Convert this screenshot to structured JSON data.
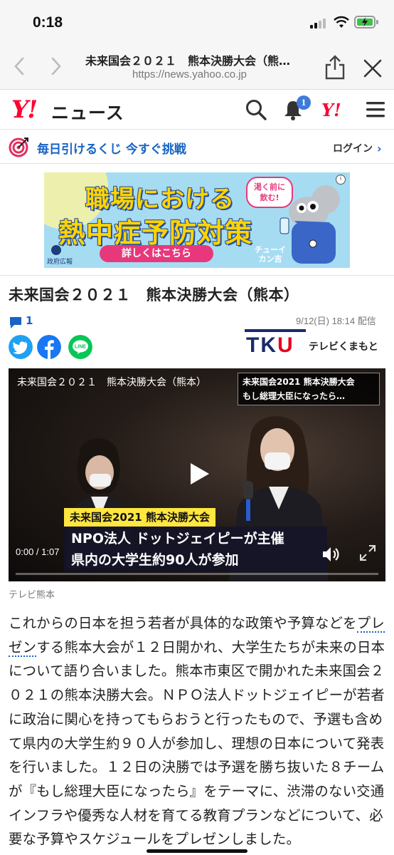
{
  "status_bar": {
    "time": "0:18"
  },
  "browser": {
    "page_title": "未来国会２０２１　熊本決勝大会（熊…",
    "url": "https://news.yahoo.co.jp"
  },
  "header": {
    "logo": "Y!",
    "section": "ニュース",
    "notification_count": "1",
    "y_small": "Y!"
  },
  "lottery": {
    "text": "毎日引けるくじ 今すぐ挑戦",
    "login": "ログイン",
    "chevron": "›"
  },
  "ad": {
    "line1": "職場における",
    "line2": "熱中症予防対策",
    "cta": "詳しくはこちら",
    "bubble": "渇く前に\n飲む!",
    "gov_label": "政府広報",
    "character_line1": "チューイ",
    "character_line2": "カン吉",
    "info": "i"
  },
  "article": {
    "title": "未来国会２０２１　熊本決勝大会（熊本）",
    "comment_count": "1",
    "date": "9/12(日) 18:14 配信",
    "publisher_letters": "TK",
    "publisher_letter_u": "U",
    "publisher_sub": "テレビくまもと"
  },
  "video": {
    "title": "未来国会２０２１　熊本決勝大会（熊本）",
    "tr_line1": "未来国会2021 熊本決勝大会",
    "tr_line2": "もし総理大臣になったら…",
    "caption1": "未来国会2021 熊本決勝大会",
    "caption2_line1": "NPO法人 ドットジェイピーが主催",
    "caption2_line2": "県内の大学生約90人が参加",
    "time": "0:00 / 1:07",
    "progress": 0
  },
  "credit": "テレビ熊本",
  "body": {
    "before": "これからの日本を担う若者が具体的な政策や予算などを",
    "link": "プレゼン",
    "after": "する熊本大会が１２日開かれ、大学生たちが未来の日本について語り合いました。熊本市東区で開かれた未来国会２０２１の熊本決勝大会。ＮＰＯ法人ドットジェイピーが若者に政治に関心を持ってもらおうと行ったもので、予選も含めて県内の大学生約９０人が参加し、理想の日本について発表を行いました。１２日の決勝では予選を勝ち抜いた８チームが『もし総理大臣になったら』をテーマに、渋滞のない交通インフラや優秀な人材を育てる教育プランなどについて、必要な予算やスケジュールをプレゼンしました。"
  },
  "colors": {
    "brand_red": "#ff0033",
    "link_blue": "#1863c5",
    "twitter": "#1da1f2",
    "facebook": "#1877f2",
    "line": "#06c755"
  }
}
